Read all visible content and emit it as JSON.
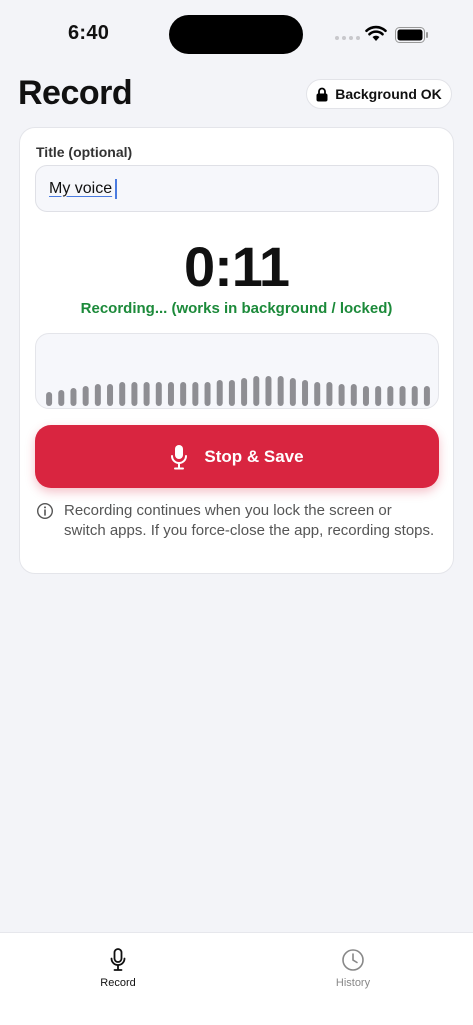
{
  "status_bar": {
    "time": "6:40"
  },
  "header": {
    "title": "Record",
    "badge_label": "Background OK"
  },
  "form": {
    "title_label": "Title (optional)",
    "title_value": "My voice"
  },
  "recorder": {
    "timer": "0:11",
    "status": "Recording... (works in background / locked)",
    "waveform_levels": [
      0.35,
      0.4,
      0.45,
      0.5,
      0.55,
      0.55,
      0.6,
      0.6,
      0.6,
      0.6,
      0.6,
      0.6,
      0.6,
      0.6,
      0.65,
      0.65,
      0.7,
      0.75,
      0.75,
      0.75,
      0.7,
      0.65,
      0.6,
      0.6,
      0.55,
      0.55,
      0.5,
      0.5,
      0.5,
      0.5,
      0.5,
      0.5
    ],
    "stop_button_label": "Stop & Save",
    "info_text": "Recording continues when you lock the screen or switch apps. If you force-close the app, recording stops."
  },
  "tabbar": {
    "tabs": [
      {
        "label": "Record",
        "icon": "microphone-icon",
        "active": true
      },
      {
        "label": "History",
        "icon": "clock-icon",
        "active": false
      }
    ]
  },
  "colors": {
    "accent_red": "#d92540",
    "status_green": "#1c8a3a",
    "wave_bar": "#8e8e93"
  }
}
